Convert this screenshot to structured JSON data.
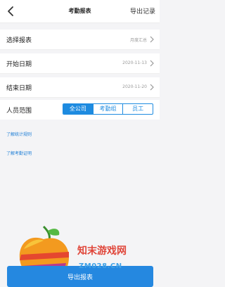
{
  "header": {
    "title": "考勤报表",
    "export_log": "导出记录"
  },
  "form": {
    "rows": [
      {
        "label": "选择报表",
        "value": "月度汇总"
      },
      {
        "label": "开始日期",
        "value": "2020-11-13"
      },
      {
        "label": "结束日期",
        "value": "2020-11-20"
      }
    ],
    "range": {
      "label": "人员范围",
      "options": [
        "全公司",
        "考勤组",
        "员工"
      ],
      "selected": "全公司"
    }
  },
  "links": {
    "stats_rules": "了解统计规则",
    "attendance_proof": "了解考勤证明"
  },
  "watermark": {
    "name": "知末游戏网",
    "domain": "ZM028.CN"
  },
  "footer": {
    "export_button": "导出报表"
  },
  "colors": {
    "accent": "#1e8be0",
    "button": "#2588e0"
  },
  "icons": [
    "back-icon",
    "chevron-right-icon"
  ]
}
